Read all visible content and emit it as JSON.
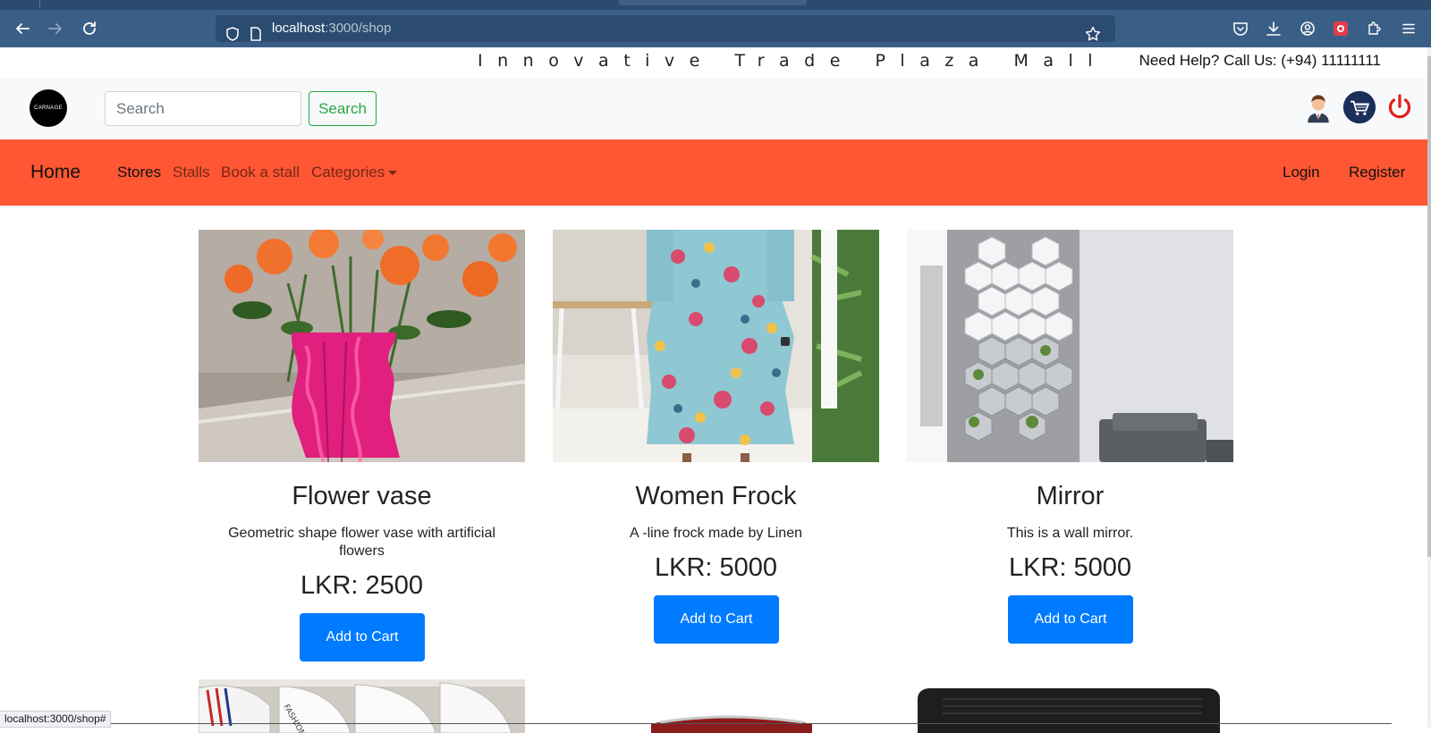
{
  "browser": {
    "url_host": "localhost",
    "url_path": ":3000/shop",
    "status_url": "localhost:3000/shop#"
  },
  "infobar": {
    "mall_title": "Innovative Trade Plaza Mall",
    "help_text": "Need Help? Call Us: (+94) 11111111"
  },
  "header": {
    "logo_text": "CARNAGE",
    "search_placeholder": "Search",
    "search_button": "Search"
  },
  "nav": {
    "brand": "Home",
    "links": [
      "Stores",
      "Stalls",
      "Book a stall",
      "Categories"
    ],
    "login": "Login",
    "register": "Register"
  },
  "products": [
    {
      "title": "Flower vase",
      "description": "Geometric shape flower vase with artificial flowers",
      "price": "LKR: 2500",
      "button": "Add to Cart"
    },
    {
      "title": "Women Frock",
      "description": "A -line frock made by Linen",
      "price": "LKR: 5000",
      "button": "Add to Cart"
    },
    {
      "title": "Mirror",
      "description": "This is a wall mirror.",
      "price": "LKR: 5000",
      "button": "Add to Cart"
    }
  ],
  "colors": {
    "nav_bg": "#ff5733",
    "primary": "#007bff",
    "success": "#28a745",
    "browser_toolbar": "#3a5f87"
  }
}
